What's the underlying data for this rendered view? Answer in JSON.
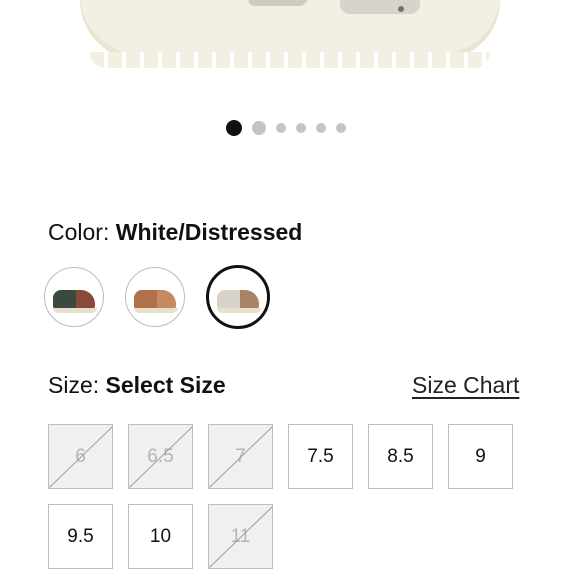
{
  "gallery": {
    "dots": [
      true,
      false,
      false,
      false,
      false,
      false
    ]
  },
  "color": {
    "label": "Color:",
    "selected": "White/Distressed",
    "swatches": [
      {
        "name": "dark-green-sandal",
        "colors": [
          "#3a4a3e",
          "#8a4a3a"
        ]
      },
      {
        "name": "tan-sandal",
        "colors": [
          "#b0704a",
          "#c48a60"
        ]
      },
      {
        "name": "white-distressed-sandal",
        "colors": [
          "#d8d2c8",
          "#a88466"
        ]
      }
    ]
  },
  "size": {
    "label": "Size:",
    "selected": "Select Size",
    "chart_link": "Size Chart",
    "options": [
      {
        "label": "6",
        "available": false
      },
      {
        "label": "6.5",
        "available": false
      },
      {
        "label": "7",
        "available": false
      },
      {
        "label": "7.5",
        "available": true
      },
      {
        "label": "8.5",
        "available": true
      },
      {
        "label": "9",
        "available": true
      },
      {
        "label": "9.5",
        "available": true
      },
      {
        "label": "10",
        "available": true
      },
      {
        "label": "11",
        "available": false
      }
    ]
  }
}
